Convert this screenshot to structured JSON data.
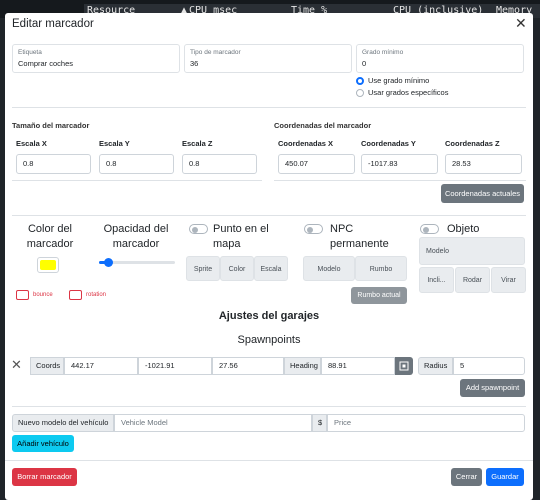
{
  "resmon": {
    "columns": [
      "Resource",
      "CPU msec",
      "Time %",
      "CPU (inclusive)",
      "Memory"
    ],
    "sort_icon": "caret-up-icon"
  },
  "modal": {
    "title": "Editar marcador",
    "close_icon": "close-icon"
  },
  "top_fields": {
    "label": {
      "label": "Etiqueta",
      "value": "Comprar coches"
    },
    "marker_type": {
      "label": "Tipo de marcador",
      "value": "36"
    },
    "min_grade": {
      "label": "Grado mínimo",
      "value": "0"
    }
  },
  "grade_options": [
    {
      "label": "Use grado mínimo",
      "selected": true
    },
    {
      "label": "Usar grados específicos",
      "selected": false
    }
  ],
  "size_section": {
    "title": "Tamaño del marcador",
    "fields": [
      {
        "label": "Escala X",
        "value": "0.8"
      },
      {
        "label": "Escala Y",
        "value": "0.8"
      },
      {
        "label": "Escala Z",
        "value": "0.8"
      }
    ]
  },
  "coords_section": {
    "title": "Coordenadas del marcador",
    "fields": [
      {
        "label": "Coordenadas X",
        "value": "450.07"
      },
      {
        "label": "Coordenadas Y",
        "value": "-1017.83"
      },
      {
        "label": "Coordenadas Z",
        "value": "28.53"
      }
    ],
    "current_button": "Coordenadas actuales"
  },
  "appearance": {
    "color_label": "Color del marcador",
    "color_value": "#ffff00",
    "opacity_label": "Opacidad del marcador",
    "opacity_fraction": 0.12,
    "bounce_label": "bounce",
    "rotation_label": "rotation",
    "map_point_label": "Punto en el mapa",
    "map_buttons": [
      "Sprite",
      "Color",
      "Escala"
    ],
    "npc_label": "NPC permanente",
    "npc_buttons": [
      "Modelo",
      "Rumbo"
    ],
    "npc_action": "Rumbo actual",
    "object_label": "Objeto",
    "object_buttons": [
      "Modelo",
      "Incli...",
      "Rodar",
      "Virar"
    ]
  },
  "garage": {
    "title": "Ajustes del garajes",
    "spawnpoints_title": "Spawnpoints",
    "row": {
      "coords_label": "Coords",
      "x": "442.17",
      "y": "-1021.91",
      "z": "27.56",
      "heading_label": "Heading",
      "heading": "88.91",
      "radius_label": "Radius",
      "radius": "5"
    },
    "add_spawnpoint": "Add spawnpoint",
    "vehicle_label": "Nuevo modelo del vehículo",
    "vehicle_placeholder": "Vehicle Model",
    "currency": "$",
    "price_placeholder": "Price",
    "add_vehicle": "Añadir vehículo"
  },
  "footer": {
    "delete": "Borrar marcador",
    "close": "Cerrar",
    "save": "Guardar"
  }
}
